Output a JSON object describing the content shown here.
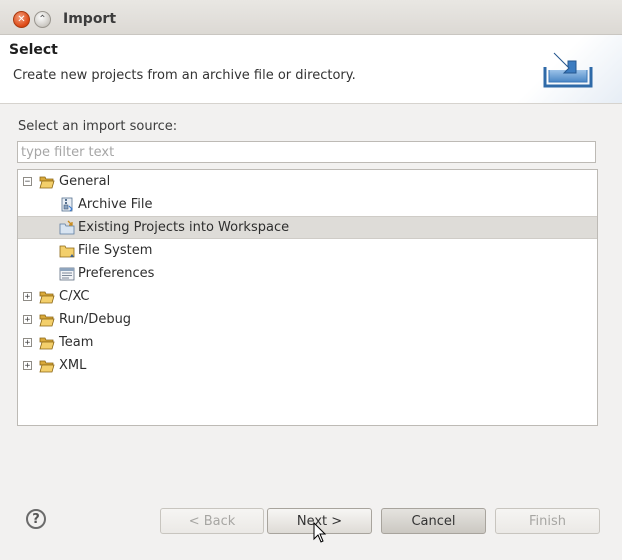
{
  "window": {
    "title": "Import",
    "close_icon": "close-icon",
    "minimize_icon": "minimize-icon"
  },
  "banner": {
    "title": "Select",
    "description": "Create new projects from an archive file or directory.",
    "icon": "import-icon"
  },
  "main": {
    "prompt": "Select an import source:",
    "filter_placeholder": "type filter text",
    "filter_value": ""
  },
  "tree": {
    "general": {
      "label": "General",
      "expanded": true,
      "icon": "folder-open-icon"
    },
    "children": [
      {
        "label": "Archive File",
        "icon": "archive-file-icon",
        "selected": false
      },
      {
        "label": "Existing Projects into Workspace",
        "icon": "existing-projects-icon",
        "selected": true
      },
      {
        "label": "File System",
        "icon": "folder-icon",
        "selected": false
      },
      {
        "label": "Preferences",
        "icon": "preferences-icon",
        "selected": false
      }
    ],
    "collapsed": [
      {
        "label": "C/XC",
        "icon": "folder-icon"
      },
      {
        "label": "Run/Debug",
        "icon": "folder-icon"
      },
      {
        "label": "Team",
        "icon": "folder-icon"
      },
      {
        "label": "XML",
        "icon": "folder-icon"
      }
    ]
  },
  "footer": {
    "help_icon": "help-icon",
    "back_label": "< Back",
    "next_label": "Next >",
    "cancel_label": "Cancel",
    "finish_label": "Finish"
  },
  "colors": {
    "selection": "#dedcd8",
    "close_button": "#dd4814"
  }
}
